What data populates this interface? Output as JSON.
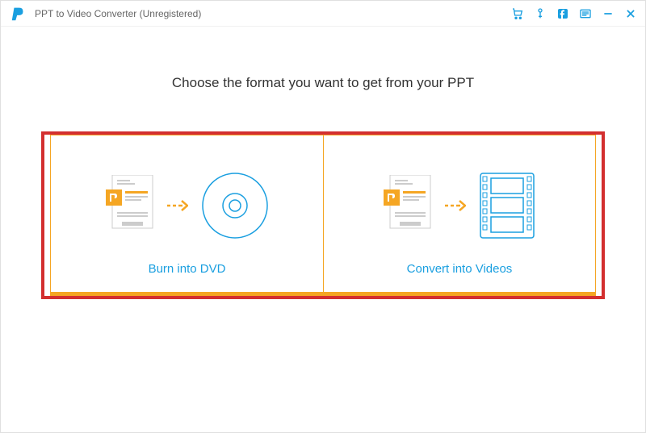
{
  "titlebar": {
    "title": "PPT to Video Converter (Unregistered)"
  },
  "heading": "Choose the format you want to get from your PPT",
  "options": {
    "dvd": {
      "label": "Burn into DVD"
    },
    "video": {
      "label": "Convert into Videos"
    }
  }
}
